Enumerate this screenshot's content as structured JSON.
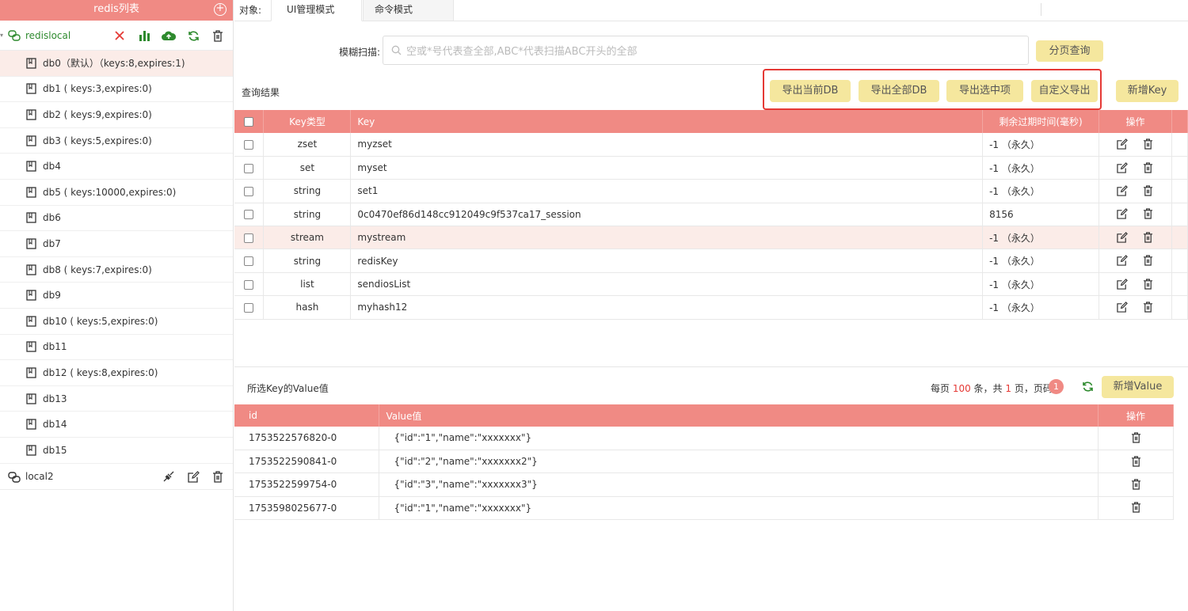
{
  "sidebar": {
    "title": "redis列表",
    "connections": [
      {
        "label": "redislocal",
        "dbs": [
          {
            "label": "db0（默认）（keys:8,expires:1)"
          },
          {
            "label": "db1 ( keys:3,expires:0)"
          },
          {
            "label": "db2 ( keys:9,expires:0)"
          },
          {
            "label": "db3 ( keys:5,expires:0)"
          },
          {
            "label": "db4"
          },
          {
            "label": "db5 ( keys:10000,expires:0)"
          },
          {
            "label": "db6"
          },
          {
            "label": "db7"
          },
          {
            "label": "db8 ( keys:7,expires:0)"
          },
          {
            "label": "db9"
          },
          {
            "label": "db10 ( keys:5,expires:0)"
          },
          {
            "label": "db11"
          },
          {
            "label": "db12 ( keys:8,expires:0)"
          },
          {
            "label": "db13"
          },
          {
            "label": "db14"
          },
          {
            "label": "db15"
          }
        ]
      },
      {
        "label": "local2"
      }
    ]
  },
  "topbar": {
    "object_label": "对象:",
    "tabs": [
      {
        "label": "UI管理模式"
      },
      {
        "label": "命令模式"
      }
    ]
  },
  "search": {
    "label": "模糊扫描:",
    "placeholder": "空或*号代表查全部,ABC*代表扫描ABC开头的全部",
    "page_query_button": "分页查询"
  },
  "results": {
    "label": "查询结果",
    "export_buttons": [
      "导出当前DB",
      "导出全部DB",
      "导出选中项",
      "自定义导出"
    ],
    "new_key_button": "新增Key",
    "columns": {
      "type": "Key类型",
      "key": "Key",
      "ttl": "剩余过期时间(毫秒)",
      "ops": "操作"
    },
    "rows": [
      {
        "type": "zset",
        "key": "myzset",
        "ttl": "-1 （永久）"
      },
      {
        "type": "set",
        "key": "myset",
        "ttl": "-1 （永久）"
      },
      {
        "type": "string",
        "key": "set1",
        "ttl": "-1 （永久）"
      },
      {
        "type": "string",
        "key": "0c0470ef86d148cc912049c9f537ca17_session",
        "ttl": "8156"
      },
      {
        "type": "stream",
        "key": "mystream",
        "ttl": "-1 （永久）"
      },
      {
        "type": "string",
        "key": "redisKey",
        "ttl": "-1 （永久）"
      },
      {
        "type": "list",
        "key": "sendiosList",
        "ttl": "-1 （永久）"
      },
      {
        "type": "hash",
        "key": "myhash12",
        "ttl": "-1 （永久）"
      }
    ]
  },
  "values": {
    "label": "所选Key的Value值",
    "pager": {
      "prefix": "每页 ",
      "per_page": "100",
      "mid": " 条，共 ",
      "total_pages": "1",
      "suffix": " 页，页码",
      "current_page": "1"
    },
    "new_value_button": "新增Value",
    "columns": {
      "id": "id",
      "value": "Value值",
      "ops": "操作"
    },
    "rows": [
      {
        "id": "1753522576820-0",
        "value": "{\"id\":\"1\",\"name\":\"xxxxxxx\"}"
      },
      {
        "id": "1753522590841-0",
        "value": "{\"id\":\"2\",\"name\":\"xxxxxxx2\"}"
      },
      {
        "id": "1753522599754-0",
        "value": "{\"id\":\"3\",\"name\":\"xxxxxxx3\"}"
      },
      {
        "id": "1753598025677-0",
        "value": "{\"id\":\"1\",\"name\":\"xxxxxxx\"}"
      }
    ]
  },
  "colors": {
    "accent": "#f08a84",
    "button": "#f5e79e",
    "highlight": "#e53935",
    "green": "#2e8a2e"
  }
}
